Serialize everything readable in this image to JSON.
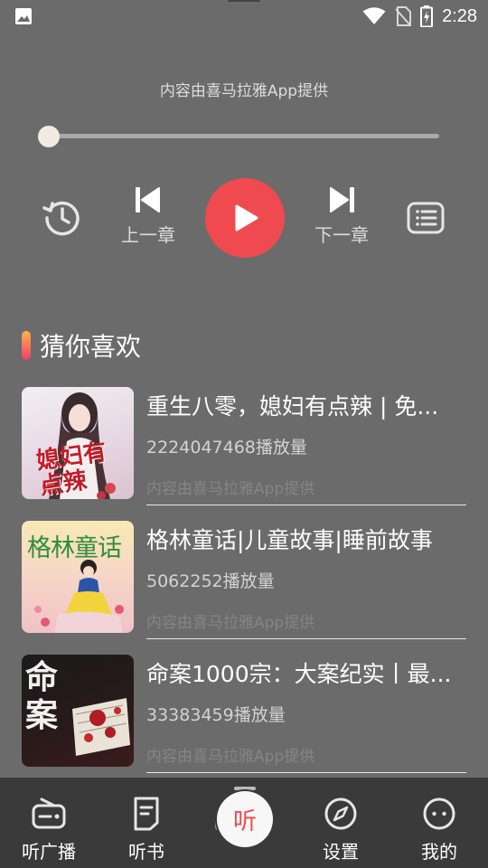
{
  "status_bar": {
    "time": "2:28",
    "icons": [
      "gallery-icon",
      "wifi-icon",
      "no-sim-icon",
      "battery-charging-icon"
    ]
  },
  "player": {
    "provider_text": "内容由喜马拉雅App提供",
    "progress": 0,
    "prev_label": "上一章",
    "next_label": "下一章",
    "accent_color": "#ef4a4f"
  },
  "section": {
    "title": "猜你喜欢"
  },
  "recommendations": [
    {
      "title": "重生八零，媳妇有点辣 | 免...",
      "plays": "2224047468播放量",
      "provider": "内容由喜马拉雅App提供",
      "cover_text": "媳妇有点辣"
    },
    {
      "title": "格林童话|儿童故事|睡前故事",
      "plays": "5062252播放量",
      "provider": "内容由喜马拉雅App提供",
      "cover_text": "格林童话"
    },
    {
      "title": "命案1000宗：大案纪实丨最...",
      "plays": "33383459播放量",
      "provider": "内容由喜马拉雅App提供",
      "cover_text": "命案"
    }
  ],
  "bottom_nav": {
    "radio_label": "听广播",
    "books_label": "听书",
    "center_label": "听",
    "settings_label": "设置",
    "mine_label": "我的"
  }
}
